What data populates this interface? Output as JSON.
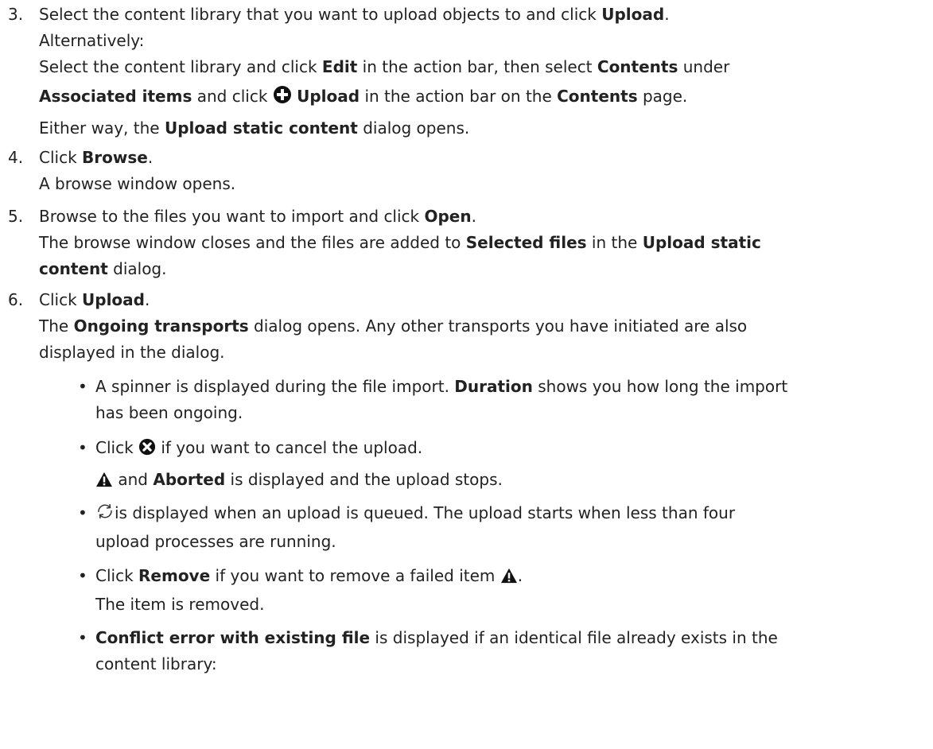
{
  "steps": [
    {
      "num": "3.",
      "lines": [
        [
          "Select the content library that you want to upload objects to and click ",
          "Upload",
          "."
        ],
        [
          "Alternatively:"
        ],
        [
          "Select the content library and click ",
          "Edit",
          " in the action bar, then select ",
          "Contents",
          " under"
        ],
        [
          "Associated items",
          " and click ",
          "Upload",
          " in the action bar on the ",
          "Contents",
          " page."
        ],
        [
          "Either way, the ",
          "Upload static content",
          " dialog opens."
        ]
      ]
    },
    {
      "num": "4.",
      "lines": [
        [
          "Click ",
          "Browse",
          "."
        ],
        [
          "A browse window opens."
        ]
      ]
    },
    {
      "num": "5.",
      "lines": [
        [
          "Browse to the files you want to import and click ",
          "Open",
          "."
        ],
        [
          "The browse window closes and the files are added to ",
          "Selected files",
          " in the ",
          "Upload static"
        ],
        [
          "content",
          " dialog."
        ]
      ]
    },
    {
      "num": "6.",
      "lines": [
        [
          "Click ",
          "Upload",
          "."
        ],
        [
          "The ",
          "Ongoing transports",
          " dialog opens. Any other transports you have initiated are also"
        ],
        [
          "displayed in the dialog."
        ]
      ]
    }
  ],
  "bullets": [
    {
      "lines": [
        [
          "A spinner is displayed during the file import. ",
          "Duration",
          " shows you how long the import"
        ],
        [
          "has been ongoing."
        ]
      ]
    },
    {
      "lines": [
        [
          "Click ",
          " if you want to cancel the upload."
        ],
        [
          " and ",
          "Aborted",
          " is displayed and the upload stops."
        ]
      ]
    },
    {
      "lines": [
        [
          "is displayed when an upload is queued. The upload starts when less than four"
        ],
        [
          "upload processes are running."
        ]
      ]
    },
    {
      "lines": [
        [
          "Click ",
          "Remove",
          " if you want to remove a failed item ",
          "."
        ],
        [
          "The item is removed."
        ]
      ]
    },
    {
      "lines": [
        [
          "Conflict error with existing file",
          " is displayed if an identical file already exists in the"
        ],
        [
          "content library:"
        ]
      ]
    }
  ],
  "icons": {
    "add": "plus-circle-icon",
    "cancel": "x-circle-icon",
    "warning": "warning-triangle-icon",
    "queued": "refresh-icon"
  },
  "bullet_char": "•"
}
